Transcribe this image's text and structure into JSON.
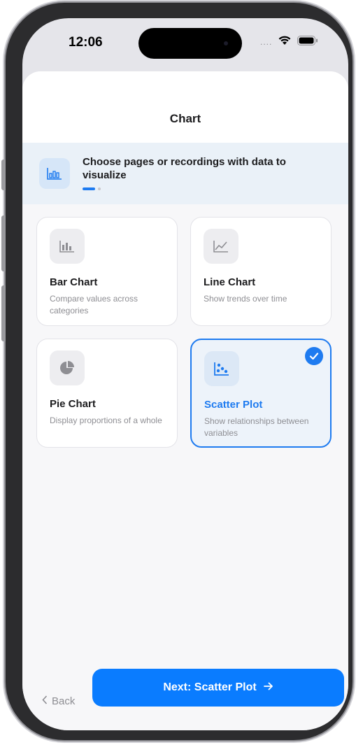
{
  "status_bar": {
    "time": "12:06",
    "signal": "....",
    "wifi_icon": "wifi-icon",
    "battery_icon": "battery-icon"
  },
  "sheet": {
    "title": "Chart"
  },
  "banner": {
    "icon": "bar-chart-icon",
    "text": "Choose pages or recordings with data to visualize",
    "pager_pages": 2,
    "pager_active": 1
  },
  "options": [
    {
      "icon": "bar-chart-icon",
      "title": "Bar Chart",
      "description": "Compare values across categories",
      "selected": false
    },
    {
      "icon": "line-chart-icon",
      "title": "Line Chart",
      "description": "Show trends over time",
      "selected": false
    },
    {
      "icon": "pie-chart-icon",
      "title": "Pie Chart",
      "description": "Display proportions of a whole",
      "selected": false
    },
    {
      "icon": "scatter-plot-icon",
      "title": "Scatter Plot",
      "description": "Show relationships between variables",
      "selected": true
    }
  ],
  "footer": {
    "back_label": "Back",
    "next_label": "Next: Scatter Plot",
    "next_icon": "arrow-right-icon"
  },
  "colors": {
    "accent": "#1e7bf0",
    "button": "#0a7cff",
    "muted_text": "#8e8e93"
  }
}
